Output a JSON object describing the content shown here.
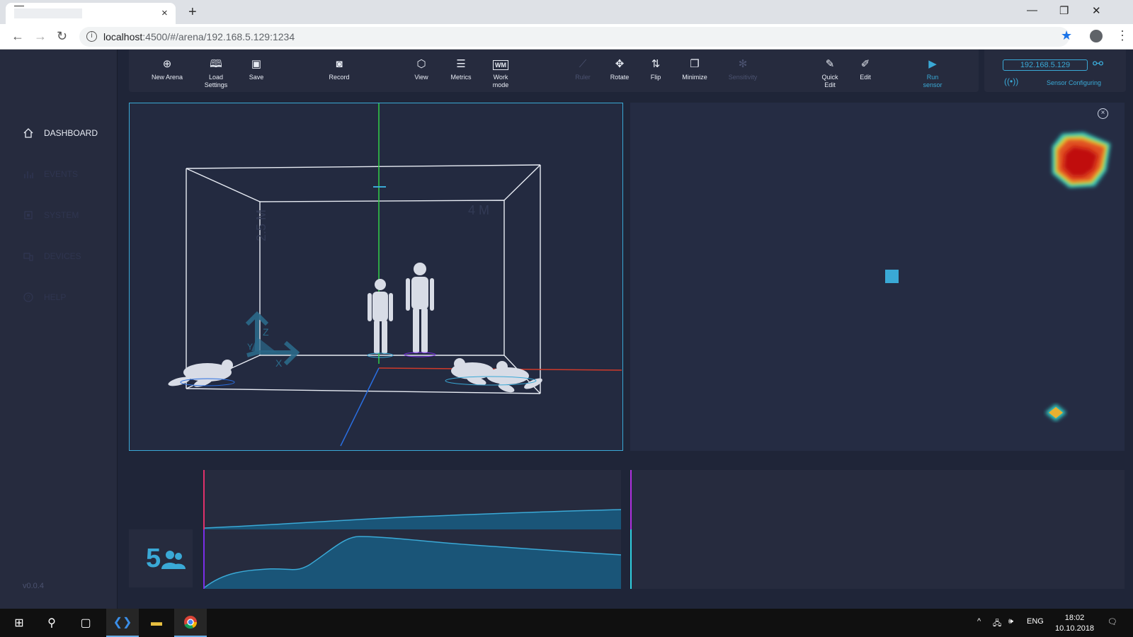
{
  "browser": {
    "url_host": "localhost",
    "url_rest": ":4500/#/arena/192.168.5.129:1234",
    "close_glyph": "×",
    "new_tab_glyph": "+"
  },
  "sidebar": {
    "items": [
      {
        "label": "DASHBOARD",
        "icon": "home-icon",
        "active": true
      },
      {
        "label": "EVENTS",
        "icon": "bar-chart-icon",
        "active": false
      },
      {
        "label": "SYSTEM",
        "icon": "chip-icon",
        "active": false
      },
      {
        "label": "DEVICES",
        "icon": "devices-icon",
        "active": false
      },
      {
        "label": "HELP",
        "icon": "help-icon",
        "active": false
      }
    ],
    "version": "v0.0.4"
  },
  "toolbar": {
    "new_arena": "New Arena",
    "load_settings_1": "Load",
    "load_settings_2": "Settings",
    "save": "Save",
    "record": "Record",
    "view": "View",
    "metrics": "Metrics",
    "work_mode_1": "Work",
    "work_mode_2": "mode",
    "work_mode_icon": "WM",
    "ruler": "Ruler",
    "rotate": "Rotate",
    "flip": "Flip",
    "minimize": "Minimize",
    "sensitivity": "Sensitivity",
    "quick_edit_1": "Quick",
    "quick_edit_2": "Edit",
    "edit": "Edit",
    "run_sensor_1": "Run",
    "run_sensor_2": "sensor"
  },
  "sensor": {
    "ip": "192.168.5.129",
    "status": "Sensor Configuring"
  },
  "scene": {
    "height_label": "2.5 M",
    "width_label": "4 M",
    "axis_z": "Z",
    "axis_x": "X",
    "axis_y": "Y"
  },
  "people_count": "5",
  "colors": {
    "accent": "#3aa9d6",
    "panel": "#262b3e",
    "background": "#1f2538",
    "chart1_border": "#e0306a",
    "chart2_border": "#7a2ee8",
    "right1_border": "#b030e0",
    "right2_border": "#30d0e0"
  },
  "taskbar": {
    "lang": "ENG",
    "time": "18:02",
    "date": "10.10.2018"
  }
}
